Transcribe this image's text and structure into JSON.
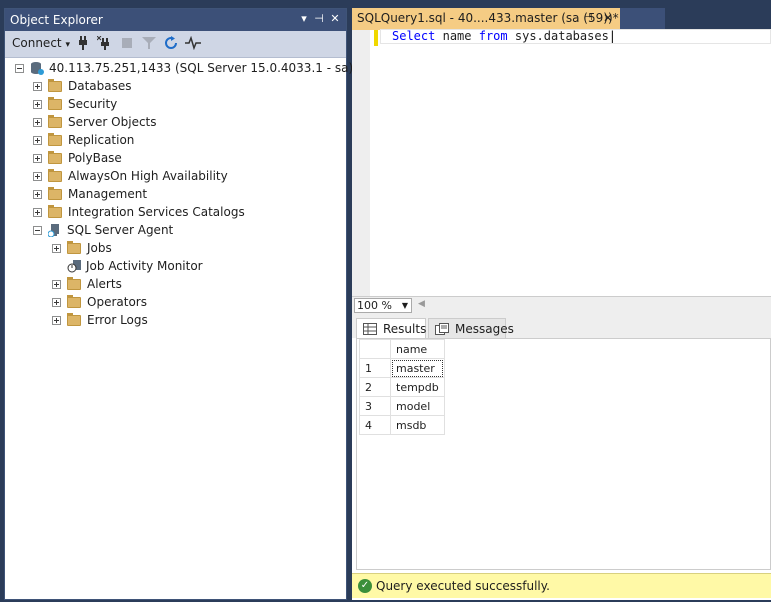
{
  "object_explorer": {
    "title": "Object Explorer",
    "toolbar": {
      "connect_label": "Connect",
      "icons": [
        "connect-plug-icon",
        "disconnect-icon",
        "stop-icon",
        "filter-icon",
        "refresh-icon",
        "activity-monitor-icon"
      ]
    },
    "tree": {
      "server": "40.113.75.251,1433 (SQL Server 15.0.4033.1 - sa)",
      "nodes": [
        "Databases",
        "Security",
        "Server Objects",
        "Replication",
        "PolyBase",
        "AlwaysOn High Availability",
        "Management",
        "Integration Services Catalogs",
        "SQL Server Agent"
      ],
      "agent_children": [
        "Jobs",
        "Job Activity Monitor",
        "Alerts",
        "Operators",
        "Error Logs"
      ]
    }
  },
  "query_tab": {
    "title": "SQLQuery1.sql - 40....433.master (sa (59))*"
  },
  "editor": {
    "kw1": "Select",
    "id1": "name",
    "kw2": "from",
    "id2": "sys.databases"
  },
  "zoom": "100 %",
  "results_tabs": {
    "results": "Results",
    "messages": "Messages"
  },
  "grid": {
    "column": "name",
    "rows": [
      {
        "num": "1",
        "name": "master"
      },
      {
        "num": "2",
        "name": "tempdb"
      },
      {
        "num": "3",
        "name": "model"
      },
      {
        "num": "4",
        "name": "msdb"
      }
    ]
  },
  "status": {
    "message": "Query executed successfully."
  },
  "colors": {
    "title_bar": "#3c5078",
    "active_tab": "#f5cc84",
    "success_bar": "#fff9a6"
  }
}
